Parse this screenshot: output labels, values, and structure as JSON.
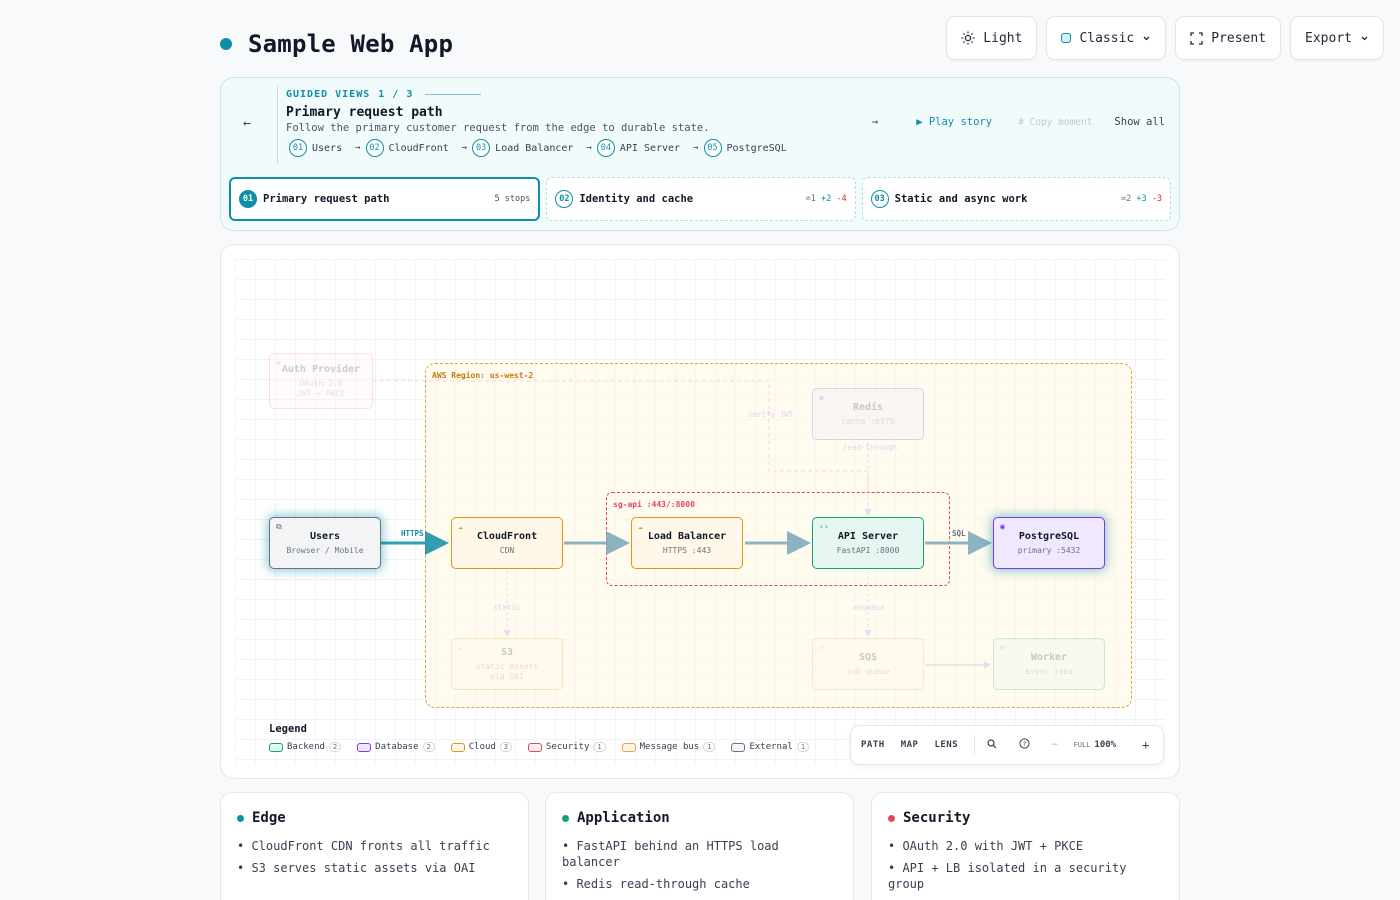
{
  "app": {
    "title": "Sample Web App"
  },
  "toolbar": {
    "theme_label": "Light",
    "style_label": "Classic",
    "present_label": "Present",
    "export_label": "Export"
  },
  "guided": {
    "eyebrow": "GUIDED VIEWS",
    "counter": "1 / 3",
    "title": "Primary request path",
    "subtitle": "Follow the primary customer request from the edge to durable state.",
    "steps": [
      {
        "num": "01",
        "label": "Users"
      },
      {
        "num": "02",
        "label": "CloudFront"
      },
      {
        "num": "03",
        "label": "Load Balancer"
      },
      {
        "num": "04",
        "label": "API Server"
      },
      {
        "num": "05",
        "label": "PostgreSQL"
      }
    ],
    "play_label": "▶ Play story",
    "copy_label": "# Copy moment",
    "show_all_label": "Show all",
    "tabs": [
      {
        "num": "01",
        "label": "Primary request path",
        "meta": "5 stops"
      },
      {
        "num": "02",
        "label": "Identity and cache",
        "meta_eq": "=1",
        "meta_plus": "+2",
        "meta_minus": "-4"
      },
      {
        "num": "03",
        "label": "Static and async work",
        "meta_eq": "=2",
        "meta_plus": "+3",
        "meta_minus": "-3"
      }
    ]
  },
  "diagram": {
    "region_label": "AWS Region: us-west-2",
    "sg_label": "sg-api :443/:8000",
    "nodes": {
      "auth": {
        "name": "Auth Provider",
        "sub": "OAuth 2.0",
        "sub2": "JWT + PKCE"
      },
      "users": {
        "name": "Users",
        "sub": "Browser / Mobile"
      },
      "cloudfront": {
        "name": "CloudFront",
        "sub": "CDN"
      },
      "lb": {
        "name": "Load Balancer",
        "sub": "HTTPS :443"
      },
      "api": {
        "name": "API Server",
        "sub": "FastAPI :8000"
      },
      "postgres": {
        "name": "PostgreSQL",
        "sub": "primary :5432"
      },
      "redis": {
        "name": "Redis",
        "sub": "cache :6379"
      },
      "s3": {
        "name": "S3",
        "sub": "static assets",
        "sub2": "via OAI"
      },
      "sqs": {
        "name": "SQS",
        "sub": "job queue"
      },
      "worker": {
        "name": "Worker",
        "sub": "async jobs"
      }
    },
    "edge_labels": {
      "https": "HTTPS",
      "sql": "SQL",
      "verify_jwt": "verify JWT",
      "read_through": "read-through",
      "static": "static",
      "enqueue": "enqueue"
    }
  },
  "legend": {
    "title": "Legend",
    "items": [
      {
        "label": "Backend",
        "count": "2",
        "color": "#10a37a",
        "fill": "#e6f7f1"
      },
      {
        "label": "Database",
        "count": "2",
        "color": "#7c3aed",
        "fill": "#efe8ff"
      },
      {
        "label": "Cloud",
        "count": "3",
        "color": "#e69318",
        "fill": "#fff7e8"
      },
      {
        "label": "Security",
        "count": "1",
        "color": "#e2475f",
        "fill": "#fff0f2"
      },
      {
        "label": "Message bus",
        "count": "1",
        "color": "#f0a24b",
        "fill": "#fff7ea"
      },
      {
        "label": "External",
        "count": "1",
        "color": "#6b7280",
        "fill": "#f3f4f6"
      }
    ]
  },
  "zoom": {
    "path_label": "PATH",
    "map_label": "MAP",
    "lens_label": "LENS",
    "full_label": "FULL",
    "level": "100%"
  },
  "cards": [
    {
      "title": "Edge",
      "color": "#0e8fa8",
      "items": [
        "CloudFront CDN fronts all traffic",
        "S3 serves static assets via OAI"
      ]
    },
    {
      "title": "Application",
      "color": "#10a37a",
      "items": [
        "FastAPI behind an HTTPS load balancer",
        "Redis read-through cache"
      ]
    },
    {
      "title": "Security",
      "color": "#e2475f",
      "items": [
        "OAuth 2.0 with JWT + PKCE",
        "API + LB isolated in a security group"
      ]
    }
  ]
}
